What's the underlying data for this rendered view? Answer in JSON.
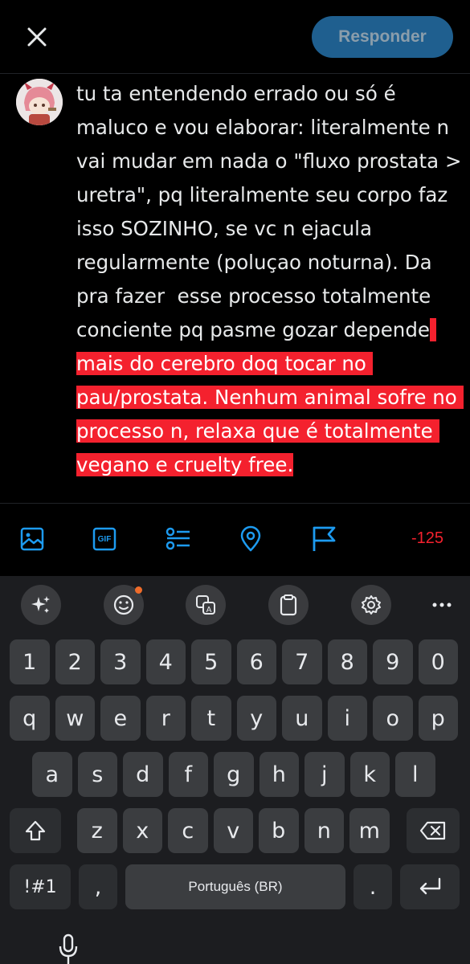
{
  "header": {
    "close_icon": "close-icon",
    "reply_label": "Responder",
    "reply_color": "#1f5f8f"
  },
  "compose": {
    "avatar_icon": "anime-avatar",
    "text_normal": "tu ta entendendo errado ou só é maluco e vou elaborar: literalmente n vai mudar em nada o \"fluxo prostata > uretra\", pq literalmente seu corpo faz isso SOZINHO, se vc n ejacula regularmente (poluçao noturna). Da pra fazer  esse processo totalmente conciente pq pasme gozar depende",
    "text_over_limit": " mais do cerebro doq tocar no pau/prostata. Nenhum animal sofre no processo n, relaxa que é totalmente vegano e cruelty free.",
    "over_limit_color": "#f4212e"
  },
  "toolbar": {
    "icons": [
      "image-icon",
      "gif-icon",
      "poll-icon",
      "location-icon",
      "flag-icon"
    ],
    "gif_label": "GIF",
    "char_counter": "-125",
    "accent_color": "#1d9bf0"
  },
  "keyboard": {
    "suggestions": [
      "sparkle-icon",
      "emoji-icon",
      "translate-icon",
      "clipboard-icon",
      "settings-icon",
      "more-icon"
    ],
    "row_numbers": [
      "1",
      "2",
      "3",
      "4",
      "5",
      "6",
      "7",
      "8",
      "9",
      "0"
    ],
    "row_1": [
      "q",
      "w",
      "e",
      "r",
      "t",
      "y",
      "u",
      "i",
      "o",
      "p"
    ],
    "row_2": [
      "a",
      "s",
      "d",
      "f",
      "g",
      "h",
      "j",
      "k",
      "l"
    ],
    "row_3": [
      "z",
      "x",
      "c",
      "v",
      "b",
      "n",
      "m"
    ],
    "symbols_label": "!#1",
    "comma_label": ",",
    "space_label": "Português (BR)",
    "period_label": ".",
    "mic_icon": "microphone-icon"
  }
}
